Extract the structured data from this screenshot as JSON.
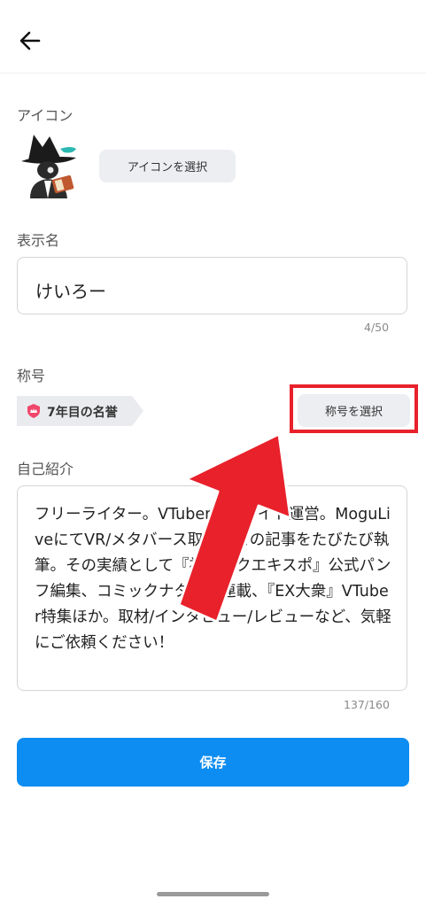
{
  "header": {
    "back_icon": "arrow-left-icon"
  },
  "icon_section": {
    "label": "アイコン",
    "select_button": "アイコンを選択"
  },
  "display_name": {
    "label": "表示名",
    "value": "けいろー",
    "counter": "4/50"
  },
  "title_section": {
    "label": "称号",
    "badge_text": "7年目の名誉",
    "badge_icon": "crown-shield-icon",
    "select_button": "称号を選択"
  },
  "bio": {
    "label": "自己紹介",
    "value": "フリーライター。VTuber情報サイト運営。MoguLiveにてVR/メタバース取材などの記事をたびたび執筆。その実績として『初音ミクエキスポ』公式パンフ編集、コミックナタリー連載、『EX大衆』VTuber特集ほか。取材/インタビュー/レビューなど、気軽にご依頼ください！",
    "counter": "137/160"
  },
  "save_button": "保存",
  "colors": {
    "accent": "#0d8df2",
    "annotation_red": "#e8212b",
    "badge_icon": "#f0466a"
  }
}
